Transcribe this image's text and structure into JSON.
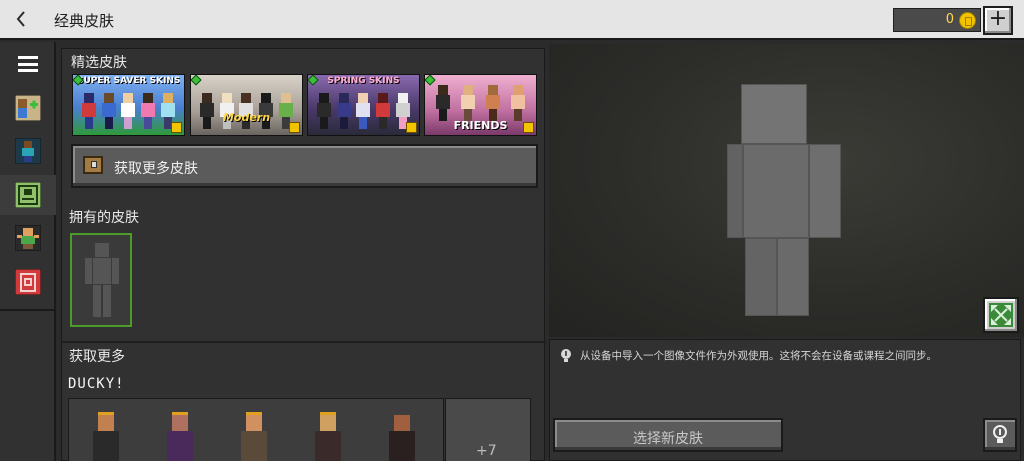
{
  "header": {
    "title": "经典皮肤",
    "coins": "0",
    "back_icon": "chevron-left-icon",
    "add_icon": "plus-icon"
  },
  "sidebar": {
    "items": [
      {
        "name": "menu",
        "icon": "menu-icon",
        "active": false
      },
      {
        "name": "character-creator",
        "icon": "character-plus-icon",
        "active": false
      },
      {
        "name": "dressing-room",
        "icon": "character-icon",
        "active": false
      },
      {
        "name": "classic-skins",
        "icon": "skin-book-icon",
        "active": true
      },
      {
        "name": "emotes",
        "icon": "emote-icon",
        "active": false
      },
      {
        "name": "capes",
        "icon": "cape-icon",
        "active": false
      }
    ]
  },
  "featured": {
    "label": "精选皮肤",
    "packs": [
      {
        "title": "SUPER SAVER SKINS",
        "color": "#5b8fd6"
      },
      {
        "title": "Modern",
        "color": "#c9c3b8"
      },
      {
        "title": "SPRING SKINS",
        "color": "#6a5a9a"
      },
      {
        "title": "FRIENDS",
        "color": "#d98ab0"
      }
    ]
  },
  "get_more_button": {
    "label": "获取更多皮肤",
    "icon": "chest-icon"
  },
  "owned": {
    "label": "拥有的皮肤"
  },
  "get_more_section": {
    "label": "获取更多",
    "pack_name": "DUCKY!",
    "more_count": "+7"
  },
  "preview": {
    "expand_icon": "expand-icon"
  },
  "import": {
    "info": "从设备中导入一个图像文件作为外观使用。这将不会在设备或课程之间同步。",
    "select_label": "选择新皮肤",
    "info_icon": "lightbulb-icon"
  },
  "colors": {
    "header_bg": "#e5e5e5",
    "panel_bg": "#313131",
    "button_bg": "#5b5b5b",
    "selected_border": "#4c9a2a",
    "coin": "#f2c400"
  }
}
